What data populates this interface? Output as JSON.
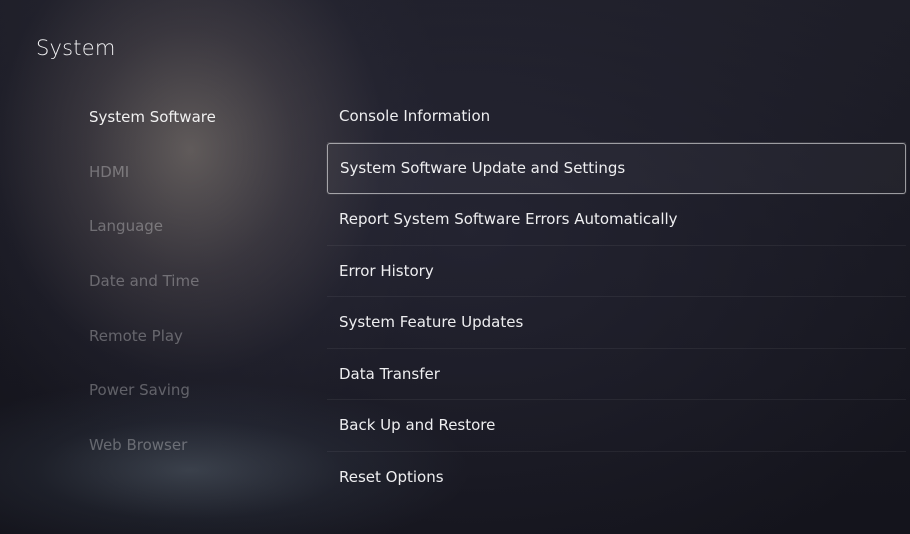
{
  "header": {
    "title": "System"
  },
  "sidebar": {
    "items": [
      {
        "label": "System Software",
        "active": true
      },
      {
        "label": "HDMI",
        "active": false
      },
      {
        "label": "Language",
        "active": false
      },
      {
        "label": "Date and Time",
        "active": false
      },
      {
        "label": "Remote Play",
        "active": false
      },
      {
        "label": "Power Saving",
        "active": false
      },
      {
        "label": "Web Browser",
        "active": false
      }
    ]
  },
  "menu": {
    "items": [
      {
        "label": "Console Information"
      },
      {
        "label": "System Software Update and Settings",
        "focused": true
      },
      {
        "label": "Report System Software Errors Automatically"
      },
      {
        "label": "Error History"
      },
      {
        "label": "System Feature Updates"
      },
      {
        "label": "Data Transfer"
      },
      {
        "label": "Back Up and Restore"
      },
      {
        "label": "Reset Options"
      }
    ]
  }
}
